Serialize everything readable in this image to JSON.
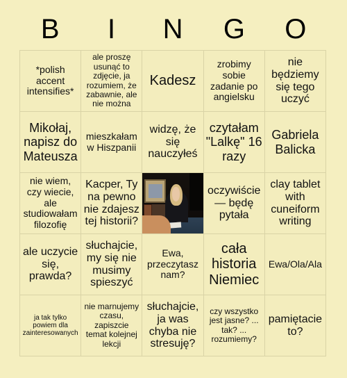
{
  "card": {
    "title_letters": [
      "B",
      "I",
      "N",
      "G",
      "O"
    ],
    "background_color": "#f5efc0",
    "grid_line_color": "#d9d3a6",
    "text_color": "#111111",
    "rows": 5,
    "columns": 5
  },
  "cells": [
    {
      "id": "b1",
      "text": "*polish accent intensifies*",
      "size": "md",
      "type": "text"
    },
    {
      "id": "i1",
      "text": "ale proszę usunąć to zdjęcie, ja rozumiem, że zabawnie, ale nie można",
      "size": "sm",
      "type": "text"
    },
    {
      "id": "n1",
      "text": "Kadesz",
      "size": "xxl",
      "type": "text"
    },
    {
      "id": "g1",
      "text": "zrobimy sobie zadanie po angielsku",
      "size": "md",
      "type": "text"
    },
    {
      "id": "o1",
      "text": "nie będziemy się tego uczyć",
      "size": "lg",
      "type": "text"
    },
    {
      "id": "b2",
      "text": "Mikołaj, napisz do Mateusza",
      "size": "xl",
      "type": "text"
    },
    {
      "id": "i2",
      "text": "mieszkałam w Hiszpanii",
      "size": "md",
      "type": "text"
    },
    {
      "id": "n2",
      "text": "widzę, że się nauczyłeś",
      "size": "lg",
      "type": "text"
    },
    {
      "id": "g2",
      "text": "czytałam \"Lalkę\" 16 razy",
      "size": "xl",
      "type": "text"
    },
    {
      "id": "o2",
      "text": "Gabriela Balicka",
      "size": "xl",
      "type": "text"
    },
    {
      "id": "b3",
      "text": "nie wiem, czy wiecie, ale studiowałam filozofię",
      "size": "md",
      "type": "text"
    },
    {
      "id": "i3",
      "text": "Kacper, Ty na pewno nie zdajesz tej historii?",
      "size": "lg",
      "type": "text"
    },
    {
      "id": "n3",
      "text": "",
      "size": "md",
      "type": "image",
      "image_description": "blonde woman in a dark top seated at a table with papers, framed pictures on the wall behind"
    },
    {
      "id": "g3",
      "text": "oczywiście — będę pytała",
      "size": "lg",
      "type": "text"
    },
    {
      "id": "o3",
      "text": "clay tablet with cuneiform writing",
      "size": "lg",
      "type": "text"
    },
    {
      "id": "b4",
      "text": "ale uczycie się, prawda?",
      "size": "lg",
      "type": "text"
    },
    {
      "id": "i4",
      "text": "słuchajcie, my się nie musimy spieszyć",
      "size": "lg",
      "type": "text"
    },
    {
      "id": "n4",
      "text": "Ewa, przeczytasz nam?",
      "size": "md",
      "type": "text"
    },
    {
      "id": "g4",
      "text": "cała historia Niemiec",
      "size": "xxl",
      "type": "text"
    },
    {
      "id": "o4",
      "text": "Ewa/Ola/Ala",
      "size": "md",
      "type": "text"
    },
    {
      "id": "b5",
      "text": "ja tak tylko powiem dla zainteresowanych",
      "size": "xs",
      "type": "text"
    },
    {
      "id": "i5",
      "text": "nie marnujemy czasu, zapiszcie temat kolejnej lekcji",
      "size": "sm",
      "type": "text"
    },
    {
      "id": "n5",
      "text": "słuchajcie, ja was chyba nie stresuję?",
      "size": "lg",
      "type": "text"
    },
    {
      "id": "g5",
      "text": "czy wszystko jest jasne? ... tak? ... rozumiemy?",
      "size": "sm",
      "type": "text"
    },
    {
      "id": "o5",
      "text": "pamiętacie to?",
      "size": "lg",
      "type": "text"
    }
  ]
}
